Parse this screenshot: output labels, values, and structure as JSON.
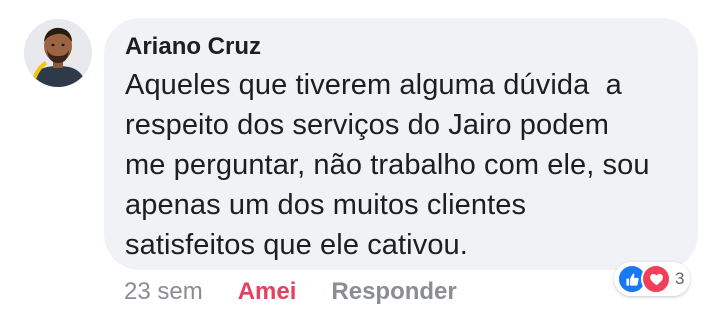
{
  "comment": {
    "author": "Ariano Cruz",
    "text": "Aqueles que tiverem alguma dúvida  a\nrespeito dos serviços do Jairo podem\nme perguntar, não trabalho com ele, sou\napenas um dos muitos clientes\nsatisfeitos que ele cativou.",
    "timestamp": "23 sem",
    "like_label": "Amei",
    "reply_label": "Responder",
    "reaction_count": "3"
  },
  "reactions": [
    {
      "icon": "thumbs-up-icon",
      "color": "#1877f2"
    },
    {
      "icon": "heart-icon",
      "color": "#f33e58"
    }
  ],
  "colors": {
    "bubble": "#f0f2f5",
    "text": "#1c1e21",
    "meta": "#8a8d91",
    "love": "#e4405f"
  }
}
